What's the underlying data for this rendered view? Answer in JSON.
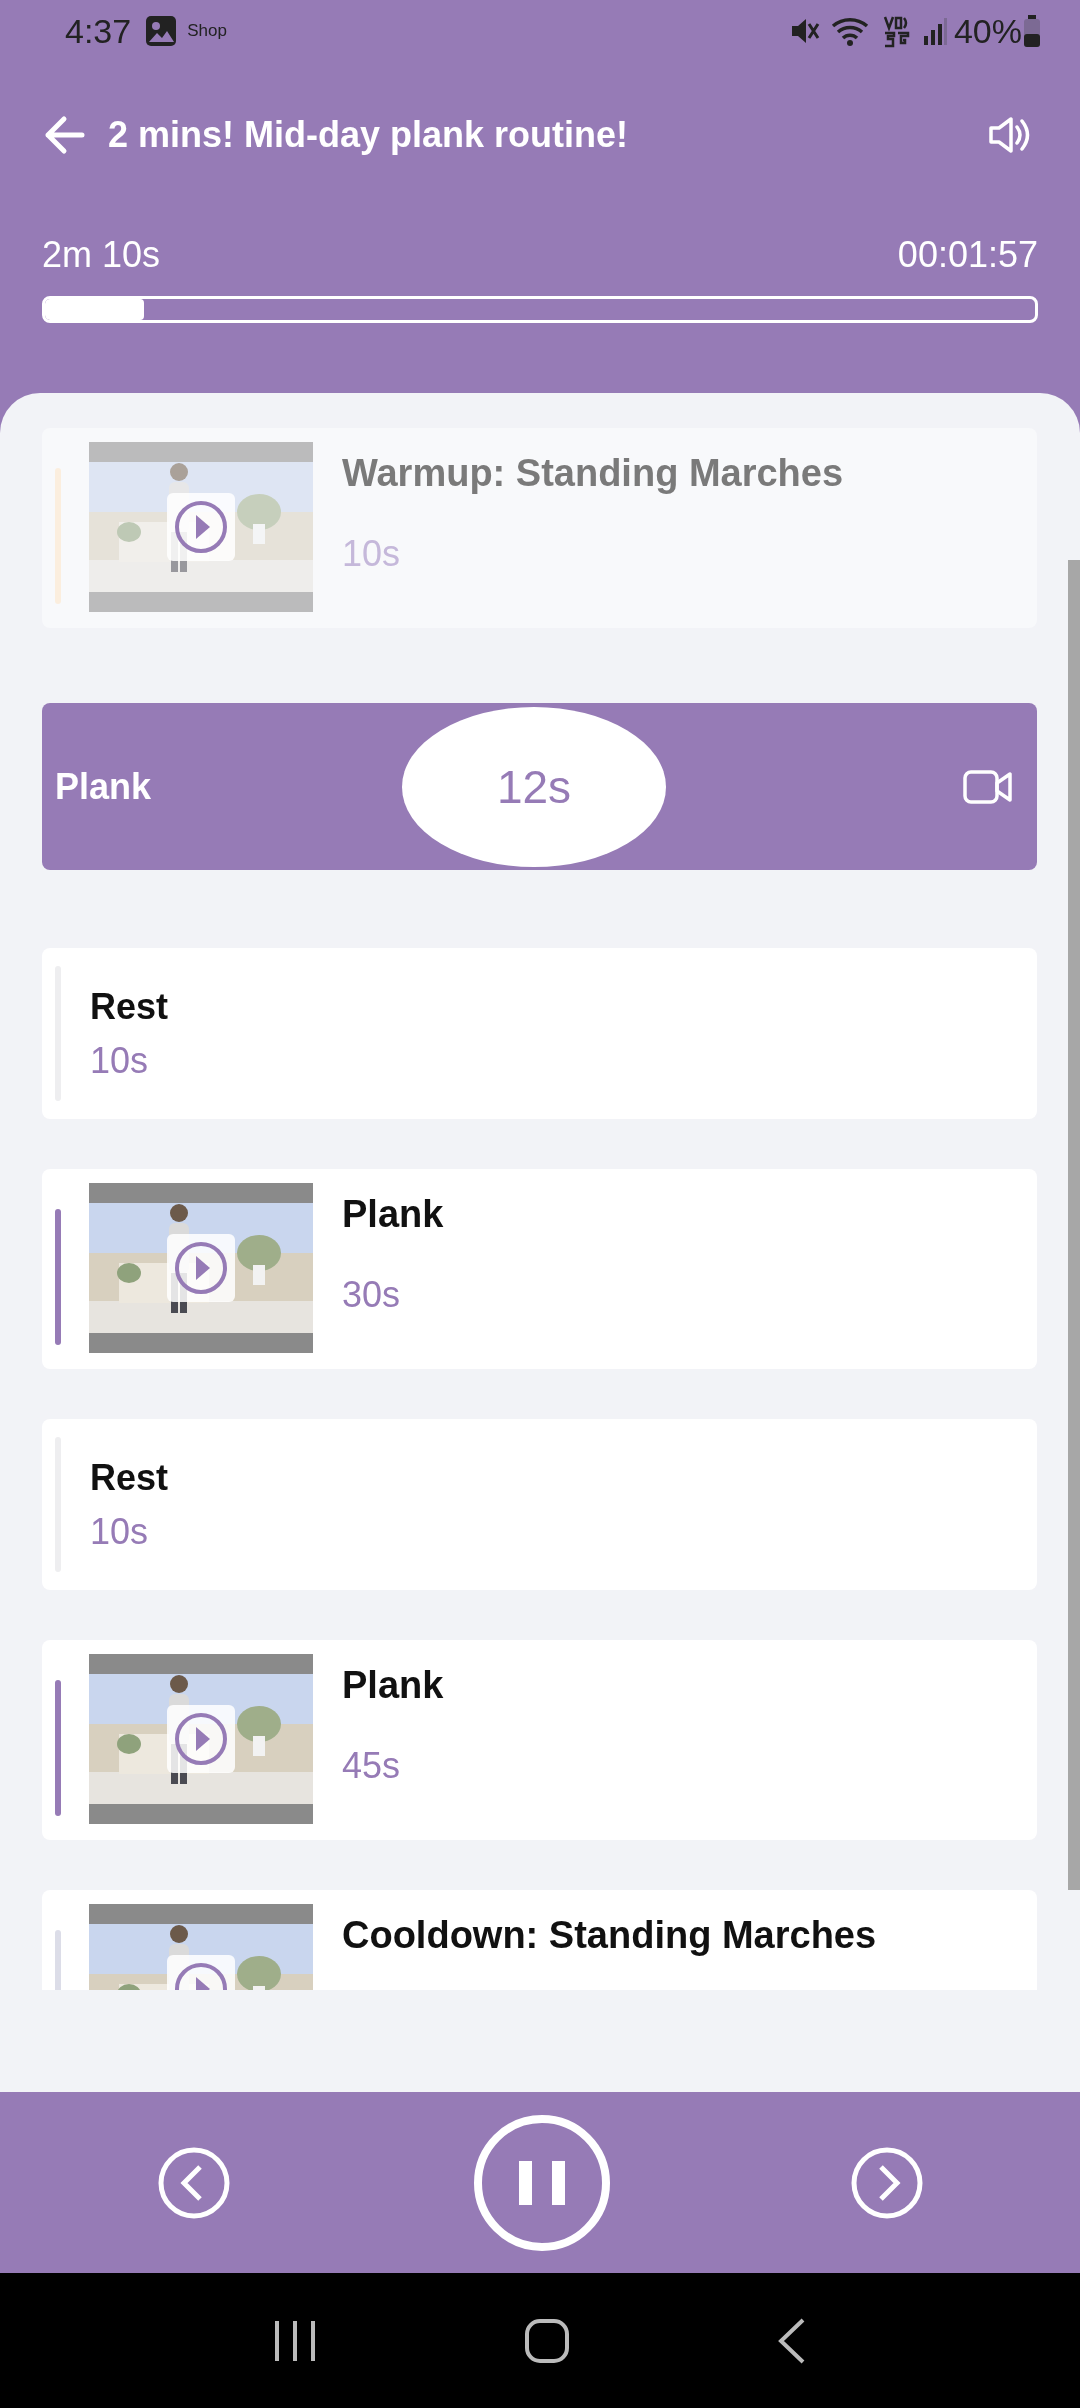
{
  "status_bar": {
    "time": "4:37",
    "notification": "Shop",
    "battery": "40%"
  },
  "header": {
    "title": "2 mins! Mid-day plank routine!"
  },
  "progress": {
    "total": "2m 10s",
    "elapsed": "00:01:57",
    "level": 0.1
  },
  "steps": [
    {
      "kind": "video",
      "title": "Warmup: Standing Marches",
      "duration": "10s",
      "done": true
    },
    {
      "kind": "active",
      "title": "Plank",
      "duration": "12s",
      "done": false
    },
    {
      "kind": "rest",
      "title": "Rest",
      "duration": "10s",
      "done": false
    },
    {
      "kind": "video",
      "title": "Plank",
      "duration": "30s",
      "done": false
    },
    {
      "kind": "rest",
      "title": "Rest",
      "duration": "10s",
      "done": false
    },
    {
      "kind": "video",
      "title": "Plank",
      "duration": "45s",
      "done": false
    },
    {
      "kind": "video",
      "title": "Cooldown: Standing Marches",
      "done": false
    }
  ]
}
